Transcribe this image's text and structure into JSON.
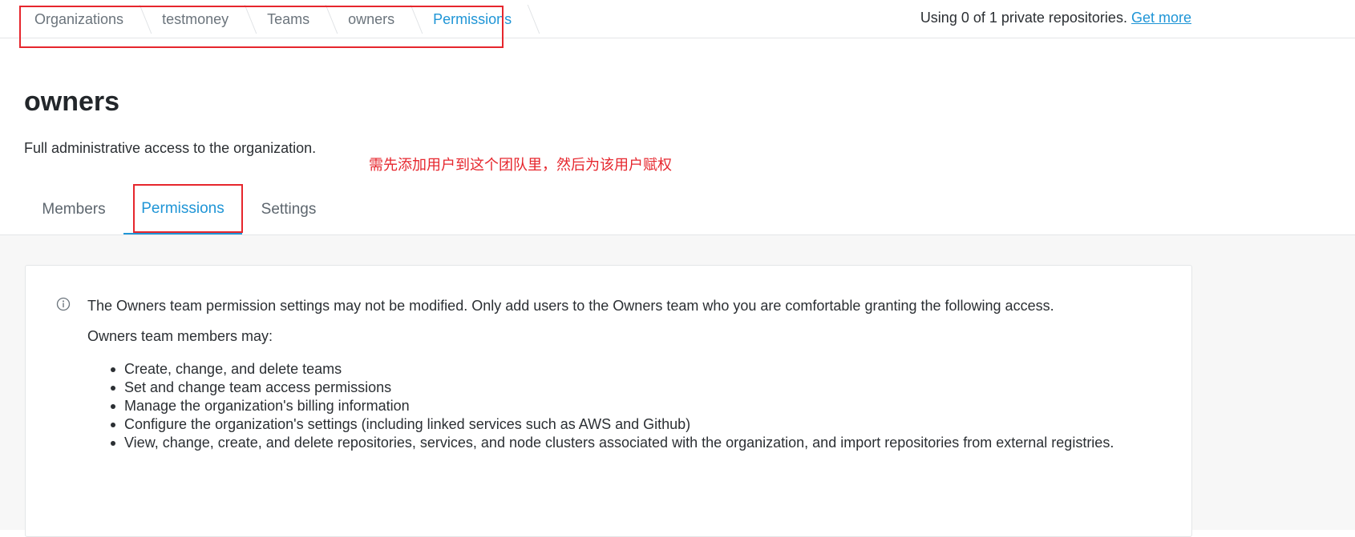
{
  "breadcrumb": {
    "items": [
      {
        "label": "Organizations"
      },
      {
        "label": "testmoney"
      },
      {
        "label": "Teams"
      },
      {
        "label": "owners"
      },
      {
        "label": "Permissions"
      }
    ]
  },
  "usage": {
    "text": "Using 0 of 1 private repositories.",
    "link": "Get more"
  },
  "team": {
    "name": "owners",
    "description": "Full administrative access to the organization."
  },
  "annotation": {
    "text": "需先添加用户到这个团队里，然后为该用户赋权",
    "color": "#e6262d"
  },
  "tabs": [
    {
      "label": "Members",
      "active": false
    },
    {
      "label": "Permissions",
      "active": true
    },
    {
      "label": "Settings",
      "active": false
    }
  ],
  "panel": {
    "icon": "info-icon",
    "notice": "The Owners team permission settings may not be modified. Only add users to the Owners team who you are comfortable granting the following access.",
    "intro": "Owners team members may:",
    "permissions": [
      "Create, change, and delete teams",
      "Set and change team access permissions",
      "Manage the organization's billing information",
      "Configure the organization's settings (including linked services such as AWS and Github)",
      "View, change, create, and delete repositories, services, and node clusters associated with the organization, and import repositories from external registries."
    ]
  },
  "colors": {
    "accent": "#1f95d6",
    "text": "#2b2f33",
    "muted": "#6b747c"
  }
}
